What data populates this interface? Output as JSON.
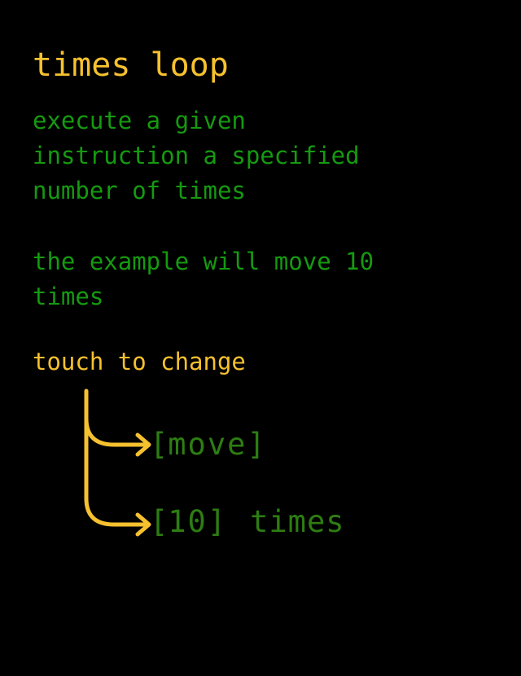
{
  "title": "times loop",
  "description": {
    "line1": "execute a given\ninstruction a specified\nnumber of times",
    "line2": "the example will move 10\ntimes"
  },
  "hint": "touch to change",
  "code": {
    "action_open": "[",
    "action_value": "move",
    "action_close": "]",
    "count_open": "[",
    "count_value": "10",
    "count_close": "]",
    "times_label": "times"
  },
  "colors": {
    "background": "#000000",
    "accent": "#f6c12f",
    "text_green": "#159a10",
    "code_green": "#2d7d12"
  },
  "icons": {
    "connector": "branch-arrow-icon"
  }
}
